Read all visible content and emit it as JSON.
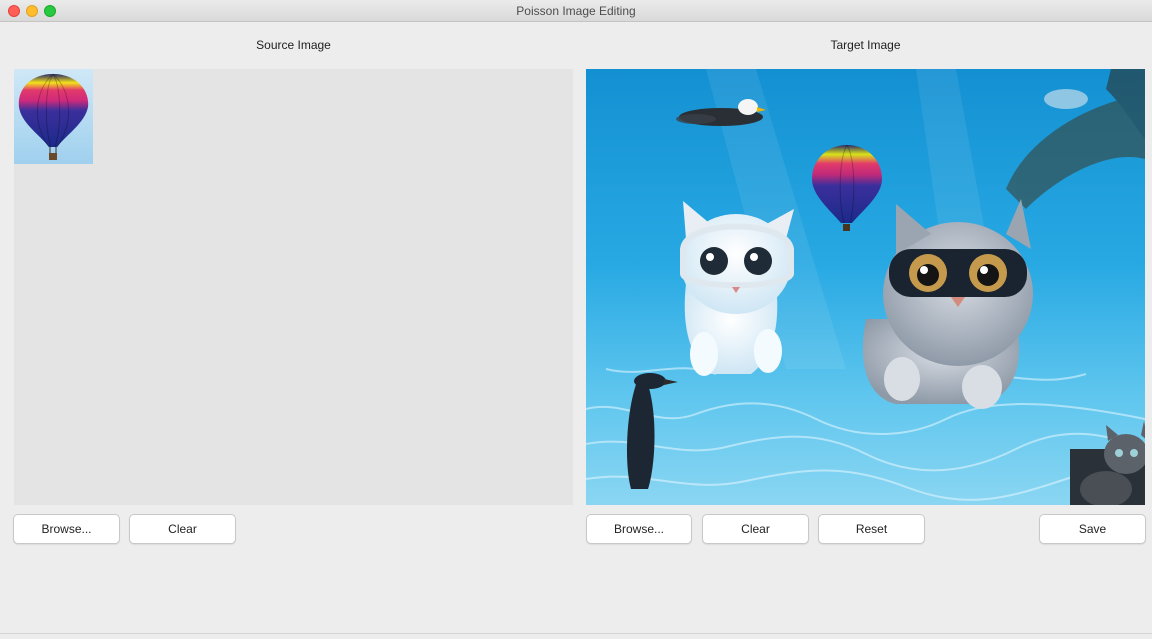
{
  "window": {
    "title": "Poisson Image Editing"
  },
  "source_panel": {
    "title": "Source Image",
    "buttons": {
      "browse": "Browse...",
      "clear": "Clear"
    }
  },
  "target_panel": {
    "title": "Target Image",
    "buttons": {
      "browse": "Browse...",
      "clear": "Clear",
      "reset": "Reset",
      "save": "Save"
    }
  },
  "colors": {
    "close": "#ff5f57",
    "minimize": "#febc2e",
    "maximize": "#28c840",
    "water": "#1e9ad6",
    "canvas_bg": "#e4e4e4"
  }
}
